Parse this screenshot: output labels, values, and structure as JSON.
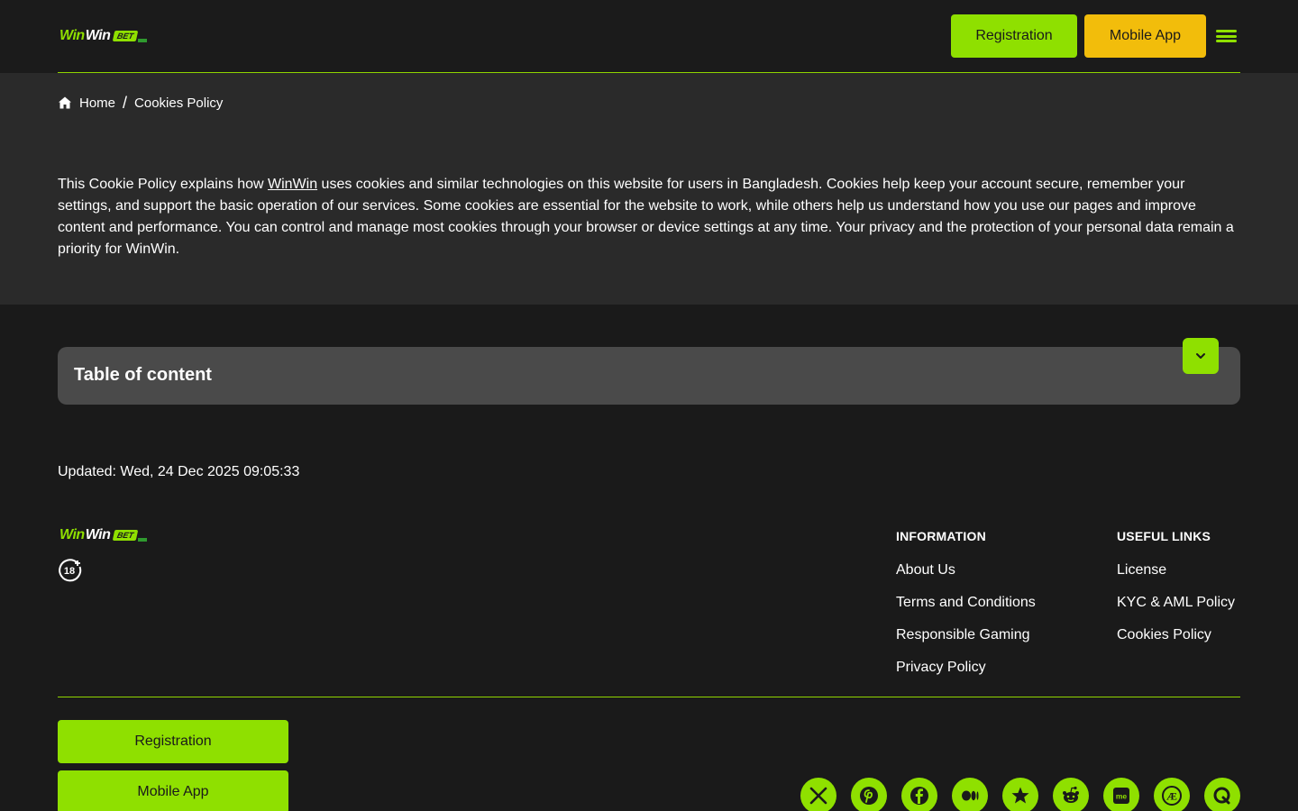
{
  "header": {
    "logo": {
      "part1": "Win",
      "part2": "Win",
      "badge": "BET",
      "alt": "WinWin BET"
    },
    "registration_label": "Registration",
    "mobile_app_label": "Mobile App",
    "menu_icon": "hamburger-icon",
    "accent_color": "#8fe000",
    "app_button_color": "#f2bd0b"
  },
  "breadcrumb": {
    "home_icon": "home-icon",
    "home_label": "Home",
    "separator": "/",
    "current_label": "Cookies Policy"
  },
  "intro": {
    "before_link": "This Cookie Policy explains how ",
    "link_text": "WinWin",
    "after_link": " uses cookies and similar technologies on this website for users in Bangladesh. Cookies help keep your account secure, remember your settings, and support the basic operation of our services. Some cookies are essential for the website to work, while others help us understand how you use our pages and improve content and performance. You can control and manage most cookies through your browser or device settings at any time. Your privacy and the protection of your personal data remain a priority for WinWin."
  },
  "toc": {
    "title": "Table of content",
    "toggle_icon": "chevron-down-icon"
  },
  "updated": "Updated: Wed, 24 Dec 2025 09:05:33",
  "footer": {
    "age_icon": "18-plus-icon",
    "information": {
      "heading": "INFORMATION",
      "links": [
        "About Us",
        "Terms and Conditions",
        "Responsible Gaming",
        "Privacy Policy"
      ]
    },
    "useful_links": {
      "heading": "USEFUL LINKS",
      "links": [
        "License",
        "KYC & AML Policy",
        "Cookies Policy"
      ]
    },
    "registration_label": "Registration",
    "mobile_app_label": "Mobile App",
    "socials": [
      "x-icon",
      "pinterest-icon",
      "facebook-icon",
      "medium-icon",
      "star-icon",
      "reddit-icon",
      "about-me-icon",
      "aspirational-icon",
      "quora-icon"
    ]
  }
}
